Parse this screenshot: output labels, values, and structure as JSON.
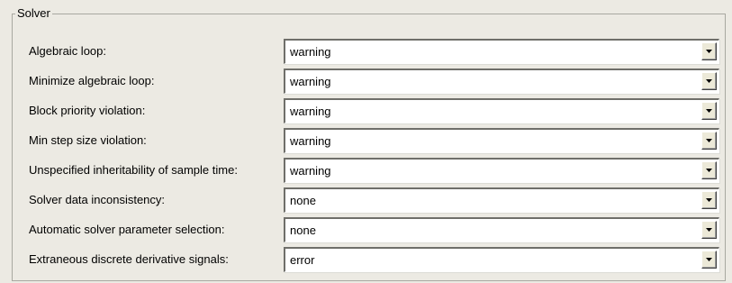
{
  "group": {
    "title": "Solver"
  },
  "options": [
    {
      "label": "Algebraic loop:",
      "value": "warning"
    },
    {
      "label": "Minimize algebraic loop:",
      "value": "warning"
    },
    {
      "label": "Block priority violation:",
      "value": "warning"
    },
    {
      "label": "Min step size violation:",
      "value": "warning"
    },
    {
      "label": "Unspecified inheritability of sample time:",
      "value": "warning"
    },
    {
      "label": "Solver data inconsistency:",
      "value": "none"
    },
    {
      "label": "Automatic solver parameter selection:",
      "value": "none"
    },
    {
      "label": "Extraneous discrete derivative signals:",
      "value": "error"
    }
  ],
  "icons": {
    "dropdown": "chevron-down-icon"
  }
}
